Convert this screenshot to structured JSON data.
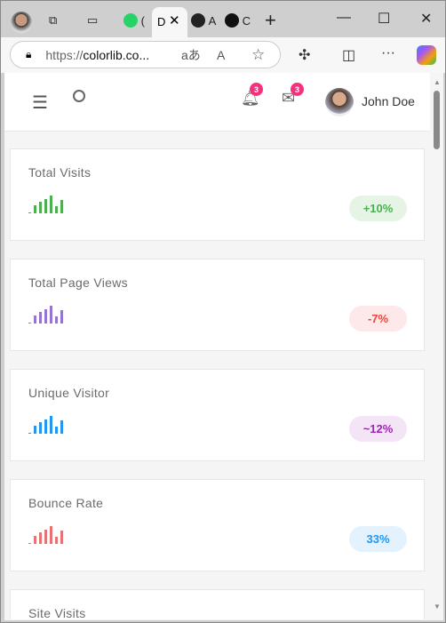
{
  "browser": {
    "tabs": [
      {
        "label": "("
      },
      {
        "label": "D"
      },
      {
        "label": "A"
      },
      {
        "label": "C"
      }
    ],
    "url_scheme": "https://",
    "url_host": "colorlib.co...",
    "new_tab": "+"
  },
  "header": {
    "notifications_count": "3",
    "messages_count": "3",
    "user_name": "John Doe"
  },
  "cards": [
    {
      "title": "Total Visits",
      "change": "+10%",
      "color": "#4caf50",
      "pill_bg": "#e6f4e6",
      "bars": [
        1,
        9,
        13,
        16,
        20,
        8,
        15
      ]
    },
    {
      "title": "Total Page Views",
      "change": "-7%",
      "color": "#9575cd",
      "text_color": "#f44336",
      "pill_bg": "#fde8ea",
      "bars": [
        1,
        9,
        13,
        16,
        20,
        8,
        15
      ]
    },
    {
      "title": "Unique Visitor",
      "change": "~12%",
      "color": "#2196f3",
      "text_color": "#9c27b0",
      "pill_bg": "#f3e5f5",
      "bars": [
        1,
        9,
        13,
        16,
        20,
        8,
        15
      ]
    },
    {
      "title": "Bounce Rate",
      "change": "33%",
      "color": "#e57373",
      "text_color": "#2196f3",
      "pill_bg": "#e3f2fd",
      "bars": [
        1,
        9,
        13,
        16,
        20,
        8,
        15
      ]
    },
    {
      "title": "Site Visits"
    }
  ]
}
